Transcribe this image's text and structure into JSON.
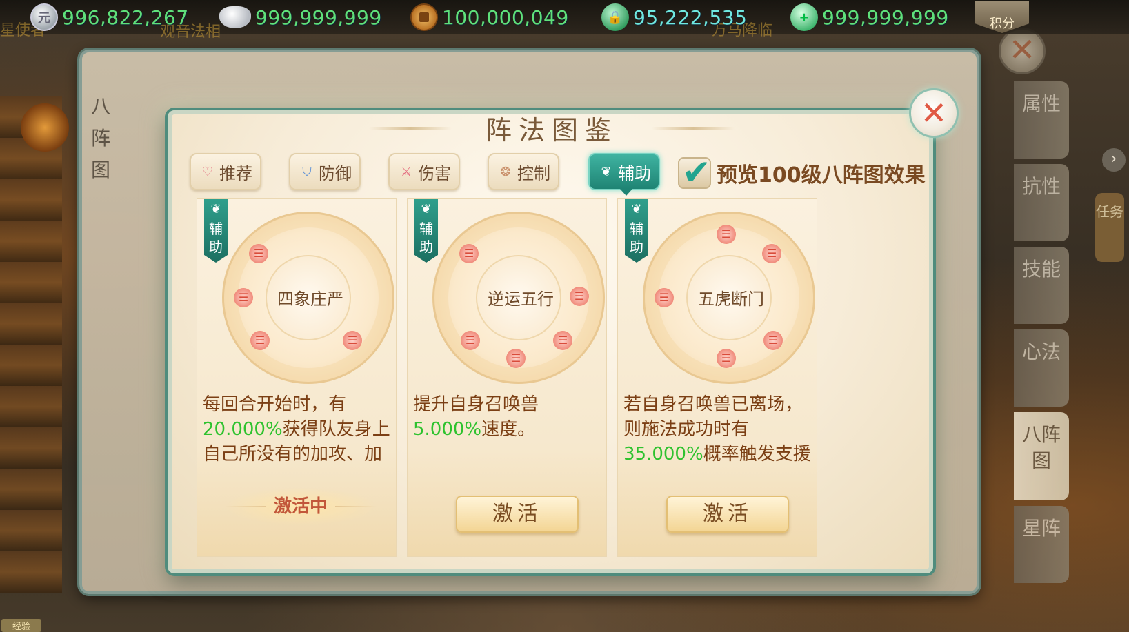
{
  "currencies": [
    {
      "icon": "silver-coin-icon",
      "value": "996,822,267"
    },
    {
      "icon": "silver-ingot-icon",
      "value": "999,999,999"
    },
    {
      "icon": "copper-coin-icon",
      "value": "100,000,049"
    },
    {
      "icon": "locked-jade-icon",
      "value": "95,222,535"
    },
    {
      "icon": "jade-plus-icon",
      "value": "999,999,999"
    }
  ],
  "topbar_labels": {
    "jifen": "积分",
    "ghost_left": "星使者",
    "ghost_mid": "观音法相",
    "ghost_right": "万马降临"
  },
  "back_panel": {
    "title": "八阵图",
    "close_glyph": "✕"
  },
  "side_tabs": [
    "属性",
    "抗性",
    "技能",
    "心法",
    "八阵图",
    "星阵"
  ],
  "side_task": "任务",
  "side_arrow": "›",
  "dialog": {
    "title": "阵法图鉴",
    "close_glyph": "✕",
    "tabs": [
      {
        "label": "推荐",
        "icon": "heart-icon",
        "glyph": "♡",
        "active": false
      },
      {
        "label": "防御",
        "icon": "shield-icon",
        "glyph": "⛉",
        "active": false
      },
      {
        "label": "伤害",
        "icon": "sword-icon",
        "glyph": "⚔",
        "active": false
      },
      {
        "label": "控制",
        "icon": "swirl-icon",
        "glyph": "❂",
        "active": false
      },
      {
        "label": "辅助",
        "icon": "leaf-icon",
        "glyph": "❦",
        "active": true
      }
    ],
    "preview": {
      "checked": true,
      "label": "预览100级八阵图效果",
      "check_glyph": "✔"
    }
  },
  "cards": [
    {
      "tag": "辅助",
      "name": "四象庄严",
      "desc_prefix": "每回合开始时，有",
      "desc_highlight": "20.000%",
      "desc_suffix": "获得队友身上自己所没有的加攻、加防、加速、治愈效果（",
      "status": "激活中",
      "button": ""
    },
    {
      "tag": "辅助",
      "name": "逆运五行",
      "desc_prefix": "提升自身召唤兽",
      "desc_highlight": "5.000%",
      "desc_suffix": "速度。",
      "status": "",
      "button": "激活"
    },
    {
      "tag": "辅助",
      "name": "五虎断门",
      "desc_prefix": "若自身召唤兽已离场，则施法成功时有",
      "desc_highlight": "35.000%",
      "desc_suffix": "概率触发支援列表召唤兽闪现（仅P",
      "status": "",
      "button": "激活"
    }
  ],
  "trigram_glyph": "☰",
  "exp_badge": "经验"
}
